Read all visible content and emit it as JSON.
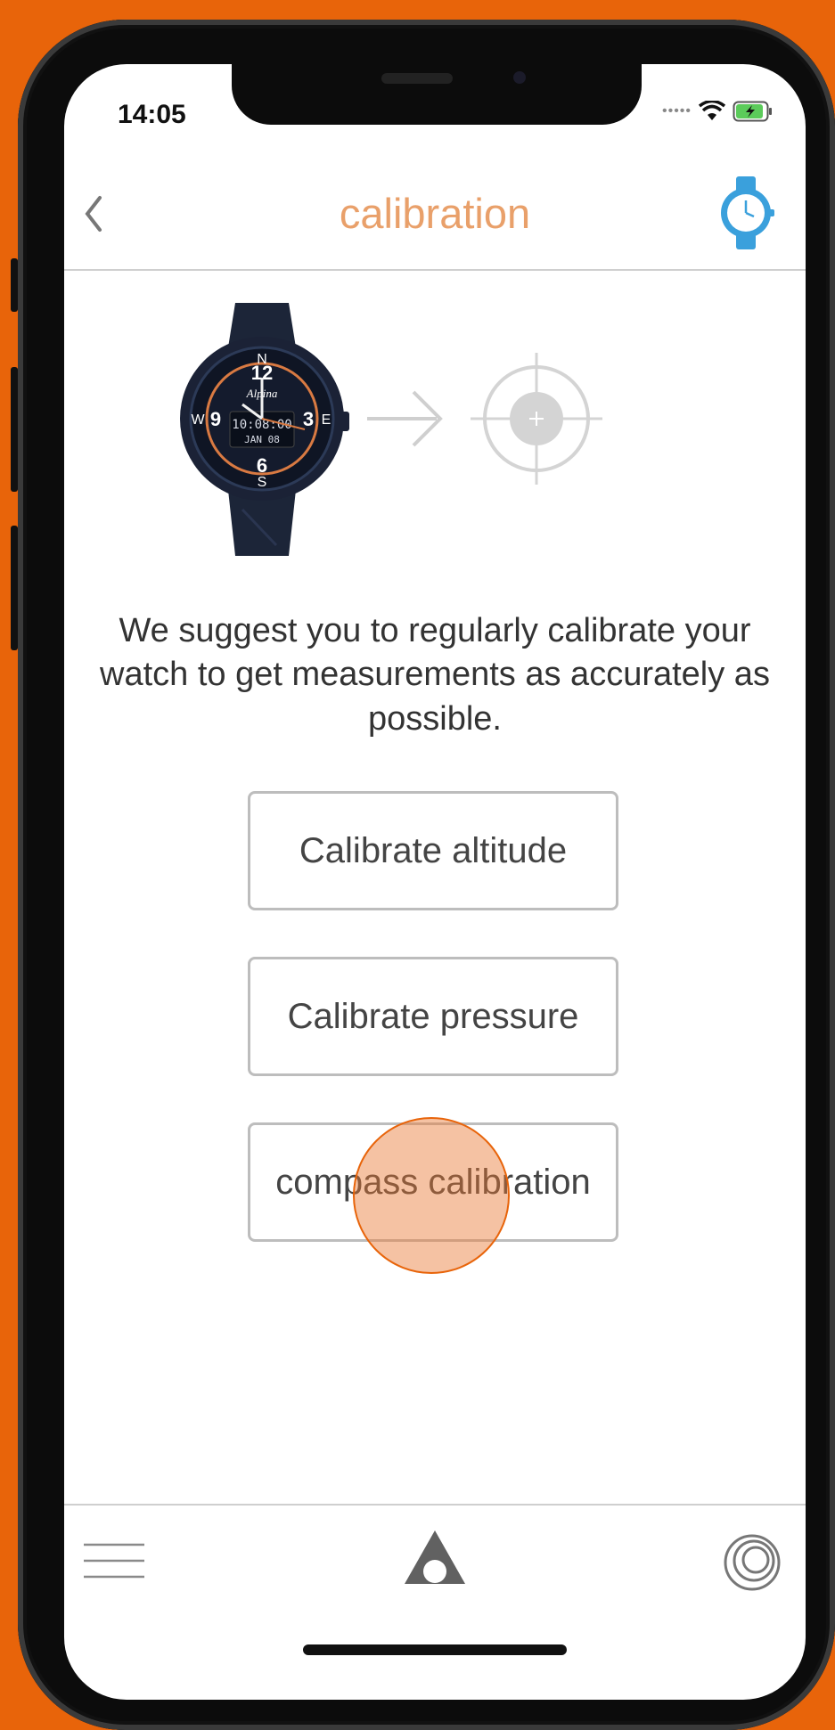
{
  "status_bar": {
    "time": "14:05"
  },
  "header": {
    "title": "calibration"
  },
  "description": "We suggest you to regularly calibrate your watch to get measurements as accurately as possible.",
  "buttons": {
    "altitude": "Calibrate altitude",
    "pressure": "Calibrate pressure",
    "compass": "compass calibration"
  },
  "colors": {
    "background": "#E8640A",
    "title": "#E9A06A",
    "watch_icon": "#3AA0DC"
  },
  "icons": {
    "back": "chevron-left-icon",
    "watch": "watch-icon",
    "menu": "hamburger-menu-icon",
    "home": "triangle-logo-icon",
    "sync": "circles-icon",
    "target": "crosshair-target-icon",
    "arrow": "arrow-right-icon"
  },
  "watch_face": {
    "brand": "Alpina",
    "time": "10:08:00",
    "date": "JAN 08"
  }
}
